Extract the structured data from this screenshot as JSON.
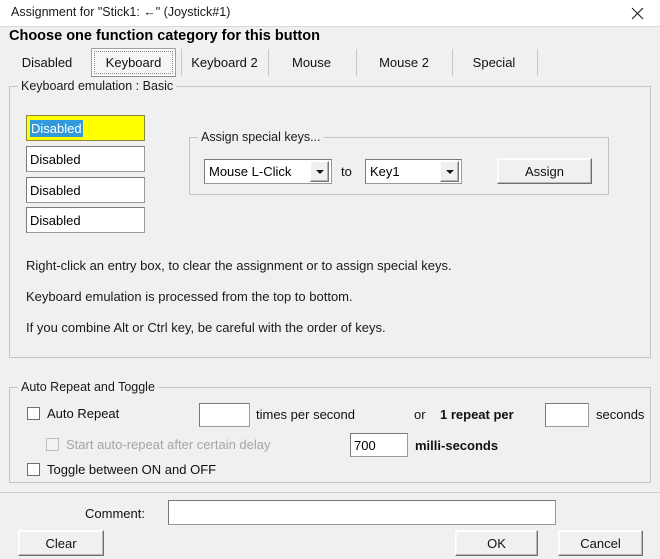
{
  "window": {
    "title": "Assignment for \"Stick1: ←\" (Joystick#1)",
    "close_icon": "close-icon"
  },
  "heading": "Choose one function category for this button",
  "tabs": [
    {
      "label": "Disabled",
      "selected": false
    },
    {
      "label": "Keyboard",
      "selected": true
    },
    {
      "label": "Keyboard 2",
      "selected": false
    },
    {
      "label": "Mouse",
      "selected": false
    },
    {
      "label": "Mouse 2",
      "selected": false
    },
    {
      "label": "Special",
      "selected": false
    }
  ],
  "keyboard_group": {
    "label": "Keyboard emulation : Basic",
    "entries": [
      {
        "value": "Disabled",
        "active": true,
        "selected": true
      },
      {
        "value": "Disabled",
        "active": false,
        "selected": false
      },
      {
        "value": "Disabled",
        "active": false,
        "selected": false
      },
      {
        "value": "Disabled",
        "active": false,
        "selected": false
      }
    ],
    "special_keys": {
      "label": "Assign special keys...",
      "source_combo": "Mouse L-Click",
      "to_label": "to",
      "target_combo": "Key1",
      "assign_button": "Assign"
    },
    "info_lines": [
      "Right-click an entry box, to clear the assignment or to assign special keys.",
      "Keyboard emulation is processed from the top to bottom.",
      "If you combine Alt or Ctrl key, be careful with the order of keys."
    ]
  },
  "auto_repeat_group": {
    "label": "Auto Repeat and Toggle",
    "auto_repeat_label": "Auto Repeat",
    "auto_repeat_checked": false,
    "rate_value": "",
    "times_per_second_label": "times per second",
    "or_label": "or",
    "one_repeat_per_label": "1 repeat per",
    "seconds_value": "",
    "seconds_label": "seconds",
    "delay_label": "Start auto-repeat after certain delay",
    "delay_checked": false,
    "delay_disabled": true,
    "delay_value": "700",
    "milliseconds_label": "milli-seconds",
    "toggle_label": "Toggle between ON and OFF",
    "toggle_checked": false
  },
  "footer": {
    "comment_label": "Comment:",
    "comment_value": "",
    "clear_button": "Clear",
    "ok_button": "OK",
    "cancel_button": "Cancel"
  },
  "colors": {
    "dialog_bg": "#f0f0f0",
    "titlebar_bg": "#ffffff",
    "active_entry_bg": "#ffff00",
    "selection_bg": "#3399dd",
    "field_bg": "#ffffff",
    "border": "#c4c4c4"
  }
}
